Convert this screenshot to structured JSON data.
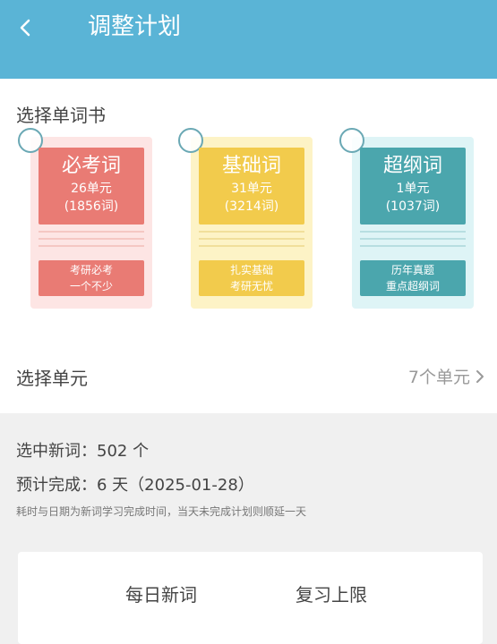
{
  "header": {
    "title": "调整计划"
  },
  "books_section": {
    "title": "选择单词书"
  },
  "books": [
    {
      "name": "必考词",
      "units": "26单元",
      "count": "(1856词)",
      "desc1": "考研必考",
      "desc2": "一个不少"
    },
    {
      "name": "基础词",
      "units": "31单元",
      "count": "(3214词)",
      "desc1": "扎实基础",
      "desc2": "考研无忧"
    },
    {
      "name": "超纲词",
      "units": "1单元",
      "count": "(1037词)",
      "desc1": "历年真题",
      "desc2": "重点超纲词"
    }
  ],
  "unit_select": {
    "label": "选择单元",
    "value": "7个单元"
  },
  "stats": {
    "new_words": "选中新词：502 个",
    "completion": "预计完成：6 天（2025-01-28）",
    "note": "耗时与日期为新词学习完成时间，当天未完成计划则顺延一天"
  },
  "tabs": {
    "daily": "每日新词",
    "review": "复习上限"
  },
  "colors": {
    "header": "#5ab4d6",
    "book1": "#e97b74",
    "book2": "#f2cb4c",
    "book3": "#4ba6ad"
  }
}
